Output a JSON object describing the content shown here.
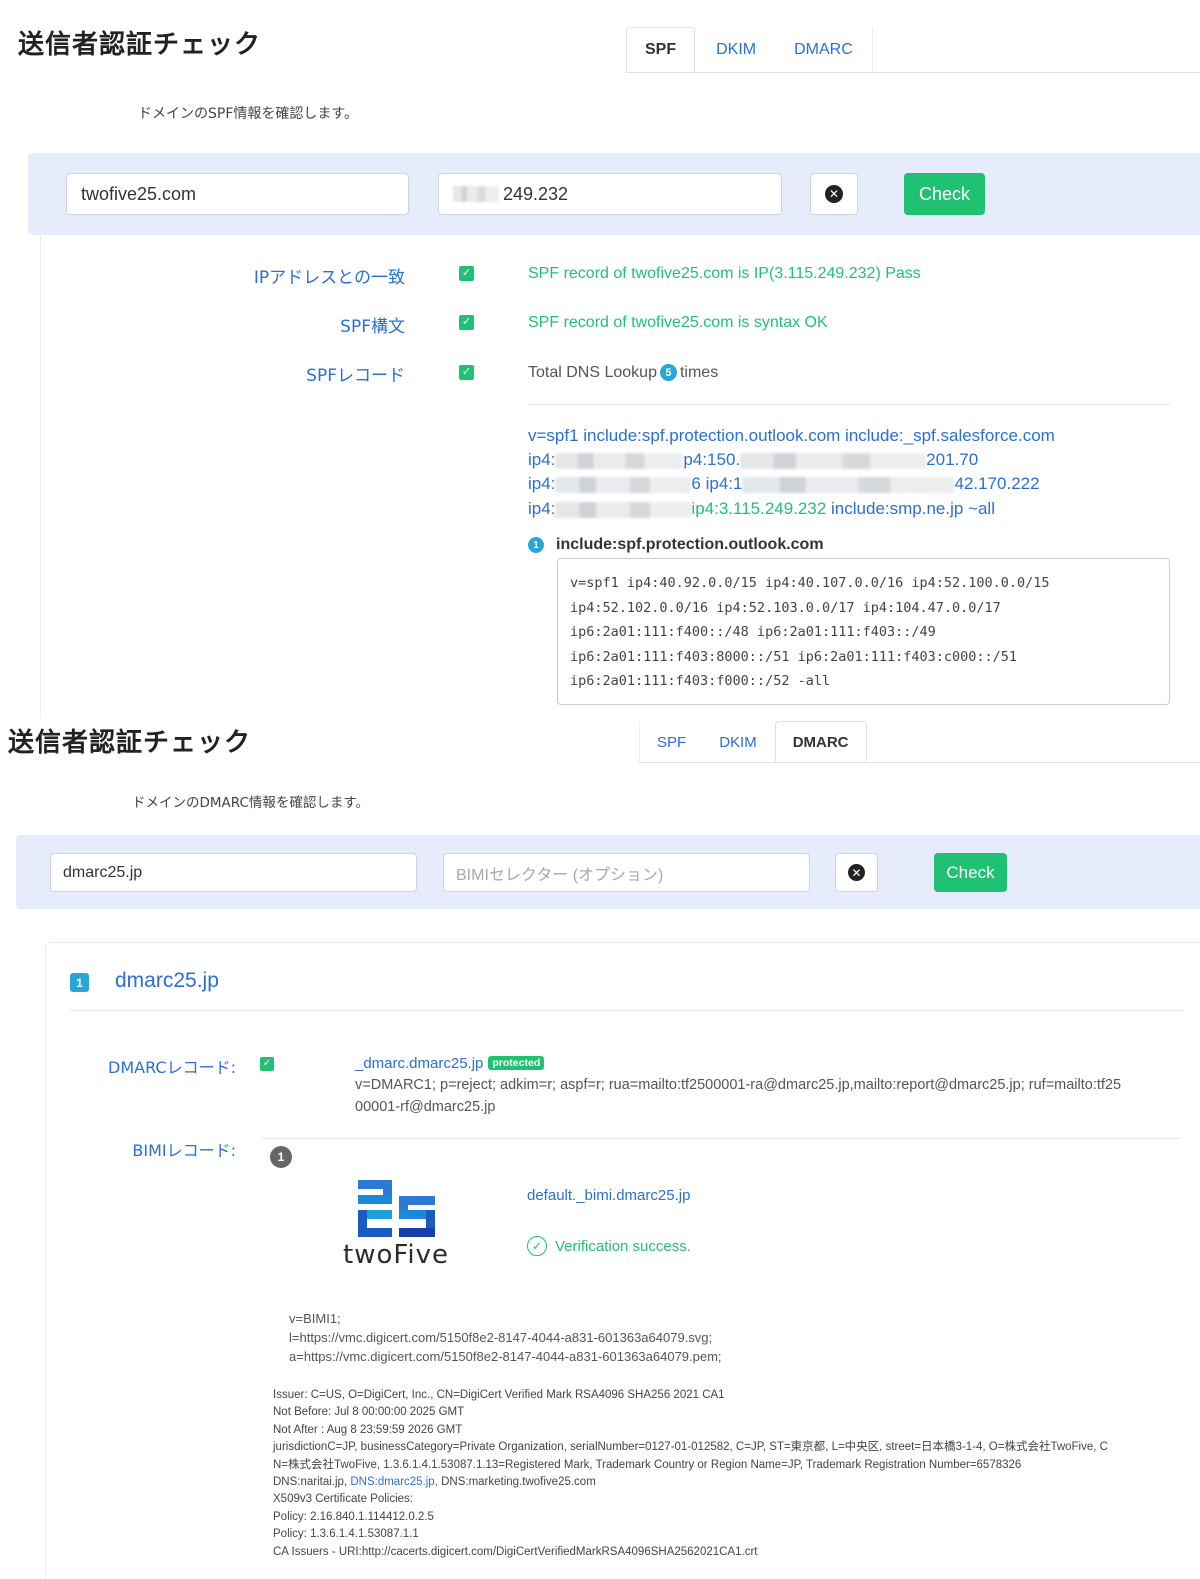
{
  "spf_panel": {
    "title": "送信者認証チェック",
    "tabs": [
      {
        "label": "SPF",
        "active": true
      },
      {
        "label": "DKIM",
        "active": false
      },
      {
        "label": "DMARC",
        "active": false
      }
    ],
    "description": "ドメインのSPF情報を確認します。",
    "domain_input": "twofive25.com",
    "ip_input_suffix": "249.232",
    "check_label": "Check",
    "results": [
      {
        "label": "IPアドレスとの一致",
        "text": "SPF record of twofive25.com is IP(3.115.249.232) Pass",
        "status": "pass"
      },
      {
        "label": "SPF構文",
        "text": "SPF record of twofive25.com is syntax OK",
        "status": "pass"
      },
      {
        "label": "SPFレコード",
        "text_before": "Total DNS Lookup",
        "lookup_count": "5",
        "text_after": "times",
        "status": "info"
      }
    ],
    "record_lines": {
      "line1": "v=spf1 include:spf.protection.outlook.com include:_spf.salesforce.com",
      "line2_a": "ip4:",
      "line2_b": "p4:150.",
      "line2_c": "201.70",
      "line3_a": "ip4:",
      "line3_b": "6 ip4:1",
      "line3_c": "42.170.222",
      "line4_a": "ip4:",
      "line4_ip": "ip4:3.115.249.232",
      "line4_c": "include:smp.ne.jp ~all"
    },
    "include": {
      "index": "1",
      "name": "include:spf.protection.outlook.com",
      "record": "v=spf1 ip4:40.92.0.0/15 ip4:40.107.0.0/16 ip4:52.100.0.0/15\nip4:52.102.0.0/16 ip4:52.103.0.0/17 ip4:104.47.0.0/17\nip6:2a01:111:f400::/48 ip6:2a01:111:f403::/49\nip6:2a01:111:f403:8000::/51 ip6:2a01:111:f403:c000::/51\nip6:2a01:111:f403:f000::/52 -all"
    }
  },
  "dmarc_panel": {
    "title": "送信者認証チェック",
    "tabs": [
      {
        "label": "SPF",
        "active": false
      },
      {
        "label": "DKIM",
        "active": false
      },
      {
        "label": "DMARC",
        "active": true
      }
    ],
    "description": "ドメインのDMARC情報を確認します。",
    "domain_input": "dmarc25.jp",
    "selector_placeholder": "BIMIセレクター (オプション)",
    "check_label": "Check",
    "result": {
      "index": "1",
      "domain": "dmarc25.jp",
      "dmarc_label": "DMARCレコード:",
      "dmarc_host": "_dmarc.dmarc25.jp",
      "protected_badge": "protected",
      "dmarc_record_line1": "v=DMARC1; p=reject; adkim=r; aspf=r; rua=mailto:tf2500001-ra@dmarc25.jp,mailto:report@dmarc25.jp; ruf=mailto:tf25",
      "dmarc_record_line2": "00001-rf@dmarc25.jp",
      "bimi_label": "BIMIレコード:",
      "bimi_index": "1",
      "logo_text": "twoFive",
      "bimi_host": "default._bimi.dmarc25.jp",
      "verification": "Verification success.",
      "bimi_record": [
        "v=BIMI1;",
        "l=https://vmc.digicert.com/5150f8e2-8147-4044-a831-601363a64079.svg;",
        "a=https://vmc.digicert.com/5150f8e2-8147-4044-a831-601363a64079.pem;"
      ],
      "cert": {
        "issuer": "Issuer: C=US, O=DigiCert, Inc., CN=DigiCert Verified Mark RSA4096 SHA256 2021 CA1",
        "not_before": "Not Before: Jul 8 00:00:00 2025 GMT",
        "not_after": "Not After : Aug 8 23:59:59 2026 GMT",
        "subject_1": "jurisdictionC=JP, businessCategory=Private Organization, serialNumber=0127-01-012582, C=JP, ST=東京都, L=中央区, street=日本橋3-1-4, O=株式会社TwoFive, C",
        "subject_2": "N=株式会社TwoFive, 1.3.6.1.4.1.53087.1.13=Registered Mark, Trademark Country or Region Name=JP, Trademark Registration Number=6578326",
        "dns_1": "DNS:naritai.jp,",
        "dns_2": "DNS:dmarc25.jp,",
        "dns_3": "DNS:marketing.twofive25.com",
        "policies": "X509v3 Certificate Policies:",
        "policy_1": "Policy: 2.16.840.1.114412.0.2.5",
        "policy_2": "Policy: 1.3.6.1.4.1.53087.1.1",
        "ca_issuers": "CA Issuers - URI:http://cacerts.digicert.com/DigiCertVerifiedMarkRSA4096SHA2562021CA1.crt"
      }
    }
  },
  "colors": {
    "accent_blue": "#2a6fd6",
    "success_green": "#21c174",
    "form_bar": "#e6ecfb",
    "badge_cyan": "#2aa6d6"
  }
}
